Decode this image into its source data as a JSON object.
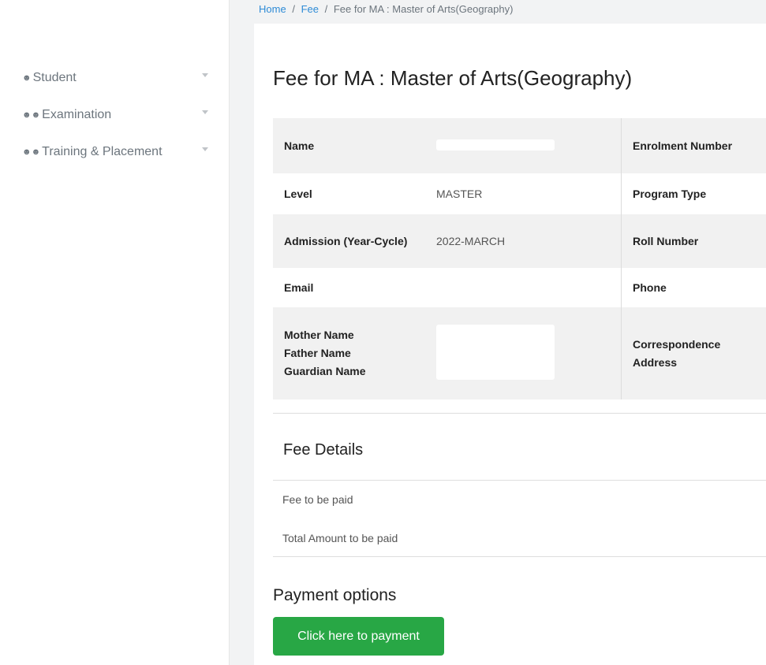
{
  "breadcrumb": {
    "home": "Home",
    "fee": "Fee",
    "current": "Fee for MA : Master of Arts(Geography)",
    "separator": "/"
  },
  "sidebar": {
    "items": [
      {
        "label": "Student",
        "icon": "user-icon"
      },
      {
        "label": "Examination",
        "icon": "users-icon"
      },
      {
        "label": "Training & Placement",
        "icon": "users-icon"
      }
    ]
  },
  "page": {
    "title": "Fee for MA : Master of Arts(Geography)"
  },
  "student_info": {
    "rows": [
      {
        "label": "Name",
        "value": "",
        "label2": "Enrolment Number"
      },
      {
        "label": "Level",
        "value": "MASTER",
        "label2": "Program Type"
      },
      {
        "label": "Admission (Year-Cycle)",
        "value": "2022-MARCH",
        "label2": "Roll Number"
      },
      {
        "label": "Email",
        "value": "",
        "label2": "Phone"
      },
      {
        "label": "Mother Name\nFather Name\nGuardian Name",
        "value": "",
        "label2": "Correspondence Address"
      }
    ]
  },
  "fee_details": {
    "title": "Fee Details",
    "fee_to_be_paid": "Fee to be paid",
    "total_amount": "Total Amount to be paid"
  },
  "payment": {
    "title": "Payment options",
    "button_label": "Click here to payment",
    "button_color": "#28a745"
  }
}
